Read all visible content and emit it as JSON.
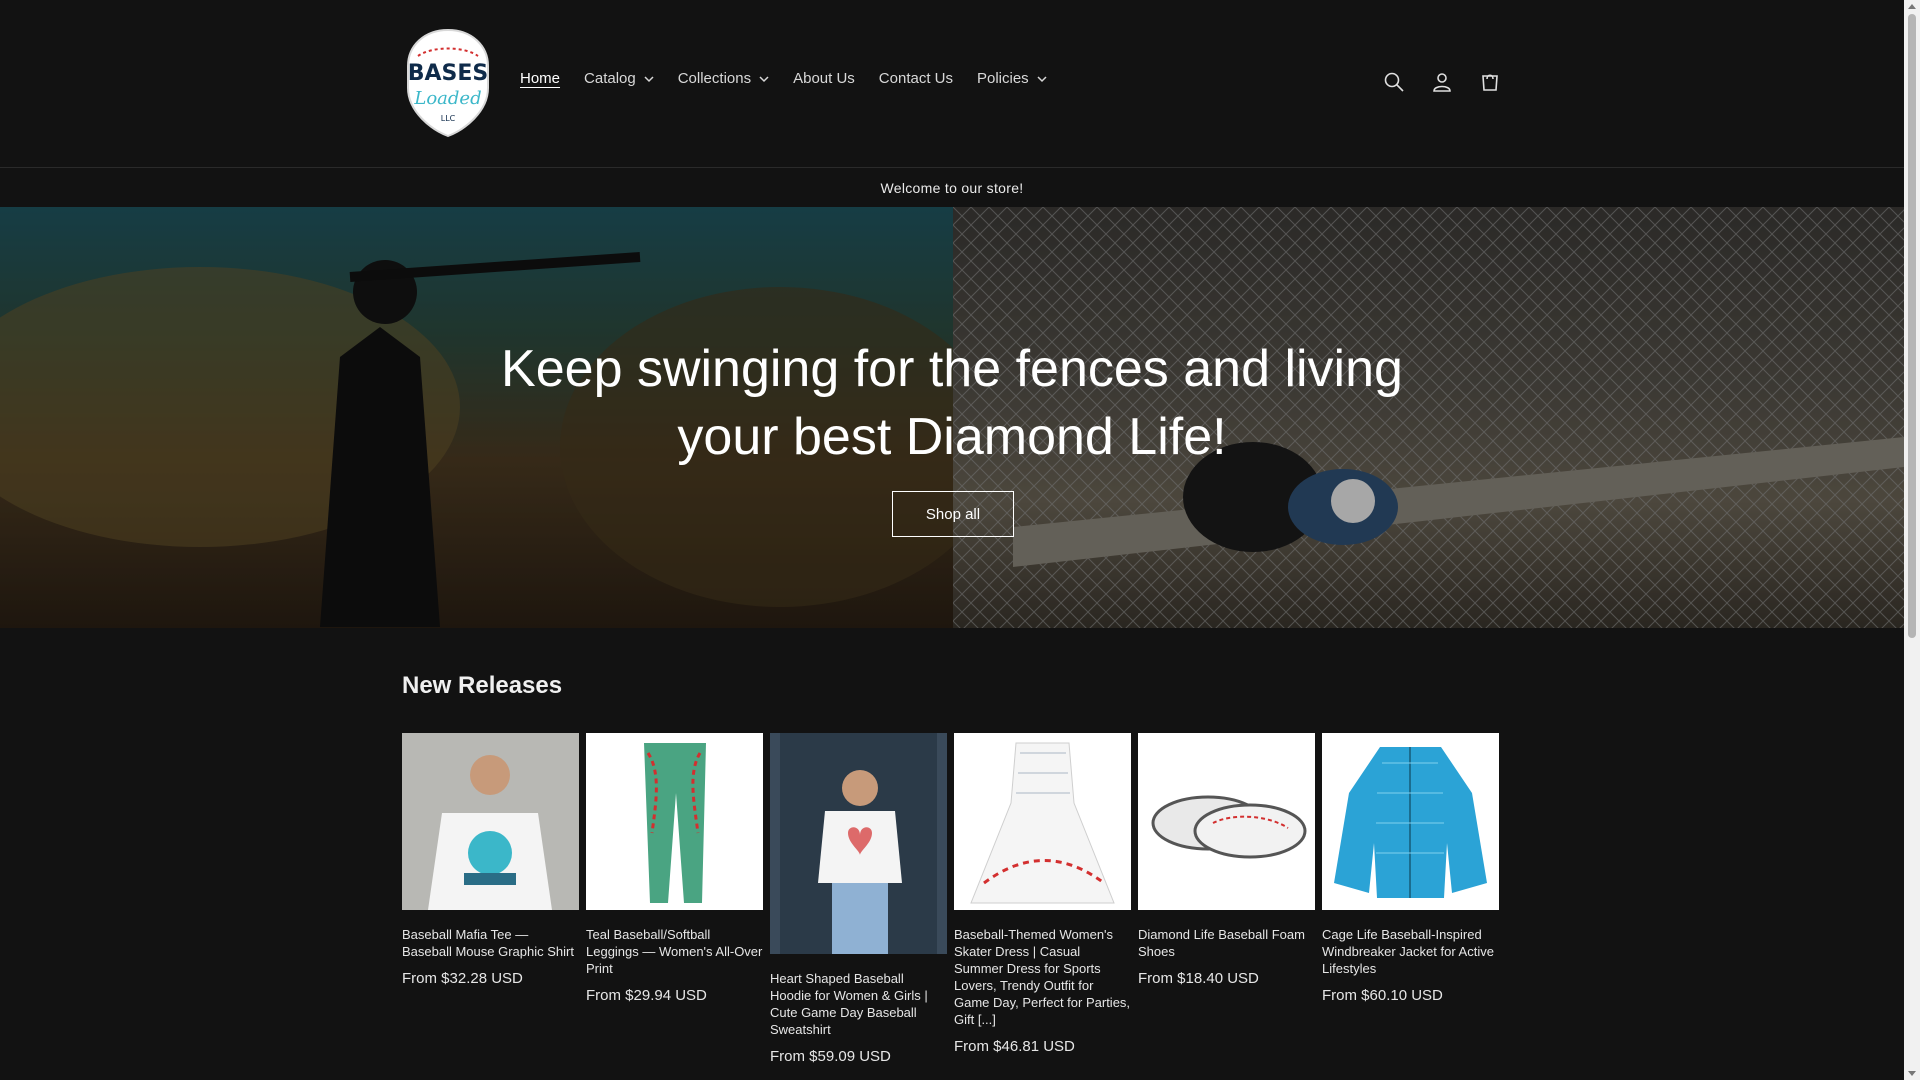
{
  "brand": {
    "logo_text_top": "BASES",
    "logo_text_mid": "Loaded",
    "logo_text_bottom": "LLC"
  },
  "nav": [
    {
      "label": "Home",
      "active": true,
      "dropdown": false
    },
    {
      "label": "Catalog",
      "dropdown": true
    },
    {
      "label": "Collections",
      "dropdown": true
    },
    {
      "label": "About Us",
      "dropdown": false
    },
    {
      "label": "Contact Us",
      "dropdown": false
    },
    {
      "label": "Policies",
      "dropdown": true
    }
  ],
  "header_icons": [
    "search-icon",
    "account-icon",
    "cart-icon"
  ],
  "announcement": "Welcome to our store!",
  "hero": {
    "title_line1": "Keep swinging for the fences and living",
    "title_line2": "your best Diamond Life!",
    "button": "Shop all"
  },
  "new_releases": {
    "title": "New Releases",
    "products": [
      {
        "title": "Baseball Mafia Tee — Baseball Mouse Graphic Shirt",
        "price": "From $32.28 USD"
      },
      {
        "title": "Teal Baseball/Softball Leggings — Women's All-Over Print",
        "price": "From $29.94 USD"
      },
      {
        "title": "Heart Shaped Baseball Hoodie for Women & Girls | Cute Game Day Baseball Sweatshirt",
        "price": "From $59.09 USD"
      },
      {
        "title": "Baseball-Themed Women's Skater Dress | Casual Summer Dress for Sports Lovers, Trendy Outfit for Game Day, Perfect for Parties, Gift [...]",
        "price": "From $46.81 USD"
      },
      {
        "title": "Diamond Life Baseball Foam Shoes",
        "price": "From $18.40 USD"
      },
      {
        "title": "Cage Life Baseball-Inspired Windbreaker Jacket for Active Lifestyles",
        "price": "From $60.10 USD"
      }
    ]
  },
  "colors": {
    "background": "#121212",
    "text": "#f2f2f2",
    "accent_teal": "#3bb7c9",
    "seam_red": "#d32f2f"
  }
}
